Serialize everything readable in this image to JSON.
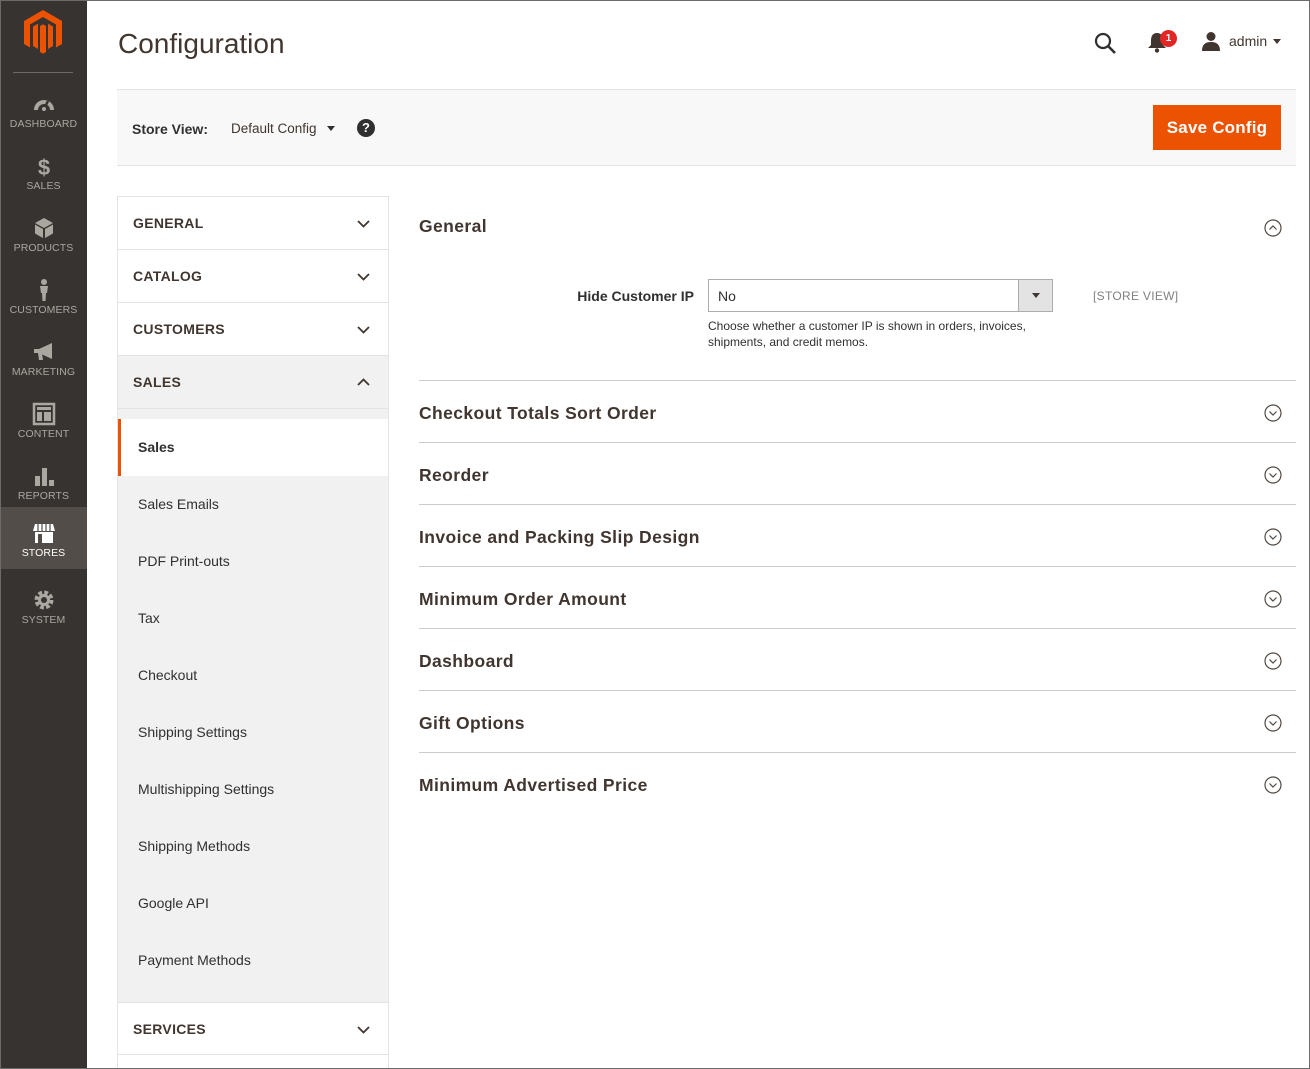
{
  "nav": {
    "items": [
      {
        "label": "DASHBOARD",
        "icon": "dashboard-icon"
      },
      {
        "label": "SALES",
        "icon": "dollar-icon"
      },
      {
        "label": "PRODUCTS",
        "icon": "box-icon"
      },
      {
        "label": "CUSTOMERS",
        "icon": "person-icon"
      },
      {
        "label": "MARKETING",
        "icon": "megaphone-icon"
      },
      {
        "label": "CONTENT",
        "icon": "layout-icon"
      },
      {
        "label": "REPORTS",
        "icon": "bar-chart-icon"
      },
      {
        "label": "STORES",
        "icon": "storefront-icon"
      },
      {
        "label": "SYSTEM",
        "icon": "gear-icon"
      }
    ],
    "active": "STORES"
  },
  "header": {
    "title": "Configuration",
    "notification_count": "1",
    "user": "admin"
  },
  "store_bar": {
    "label": "Store View:",
    "selected": "Default Config",
    "help": "?",
    "save_label": "Save Config"
  },
  "sidebar": {
    "tabs": [
      {
        "label": "GENERAL",
        "open": false
      },
      {
        "label": "CATALOG",
        "open": false
      },
      {
        "label": "CUSTOMERS",
        "open": false
      },
      {
        "label": "SALES",
        "open": true
      },
      {
        "label": "SERVICES",
        "open": false
      }
    ],
    "sales_items": [
      "Sales",
      "Sales Emails",
      "PDF Print-outs",
      "Tax",
      "Checkout",
      "Shipping Settings",
      "Multishipping Settings",
      "Shipping Methods",
      "Google API",
      "Payment Methods"
    ],
    "active_item": "Sales"
  },
  "main": {
    "general": {
      "title": "General",
      "field_label": "Hide Customer IP",
      "field_value": "No",
      "field_note": "Choose whether a customer IP is shown in orders, invoices, shipments, and credit memos.",
      "field_scope": "[STORE VIEW]"
    },
    "sections": [
      "Checkout Totals Sort Order",
      "Reorder",
      "Invoice and Packing Slip Design",
      "Minimum Order Amount",
      "Dashboard",
      "Gift Options",
      "Minimum Advertised Price"
    ]
  },
  "colors": {
    "accent": "#eb5202",
    "nav_bg": "#373330",
    "nav_active": "#524d49"
  }
}
